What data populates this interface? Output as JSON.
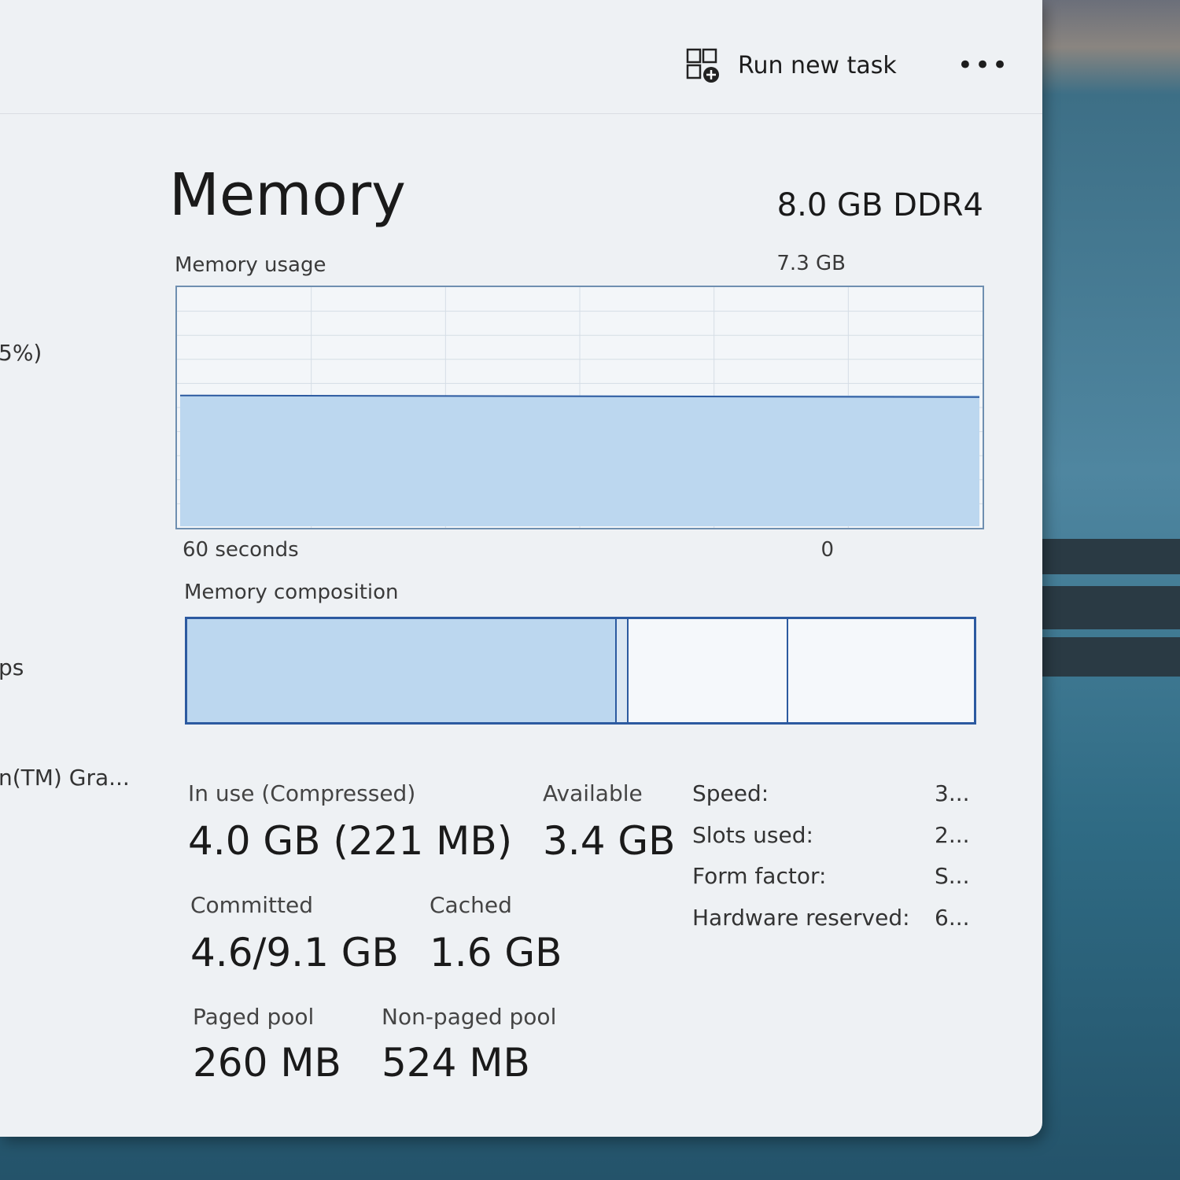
{
  "toolbar": {
    "run_new_task_label": "Run new task",
    "more_label": "•••"
  },
  "sidebar_fragments": [
    "5%)",
    "ps",
    "n(TM) Gra..."
  ],
  "memory": {
    "title": "Memory",
    "spec": "8.0 GB DDR4",
    "usage_label": "Memory usage",
    "usage_max": "7.3 GB",
    "time_left": "60 seconds",
    "time_right": "0",
    "composition_label": "Memory composition",
    "usage_fraction": 0.55
  },
  "stats": {
    "in_use_label": "In use (Compressed)",
    "in_use_value": "4.0 GB (221 MB)",
    "available_label": "Available",
    "available_value": "3.4 GB",
    "committed_label": "Committed",
    "committed_value": "4.6/9.1 GB",
    "cached_label": "Cached",
    "cached_value": "1.6 GB",
    "paged_label": "Paged pool",
    "paged_value": "260 MB",
    "nonpaged_label": "Non-paged pool",
    "nonpaged_value": "524 MB"
  },
  "info": [
    {
      "label": "Speed:",
      "value": "3..."
    },
    {
      "label": "Slots used:",
      "value": "2..."
    },
    {
      "label": "Form factor:",
      "value": "S..."
    },
    {
      "label": "Hardware reserved:",
      "value": "6..."
    }
  ],
  "colors": {
    "graph_fill": "#bcd7ef",
    "graph_line": "#2c5aa0",
    "graph_grid": "#d5dde6"
  }
}
